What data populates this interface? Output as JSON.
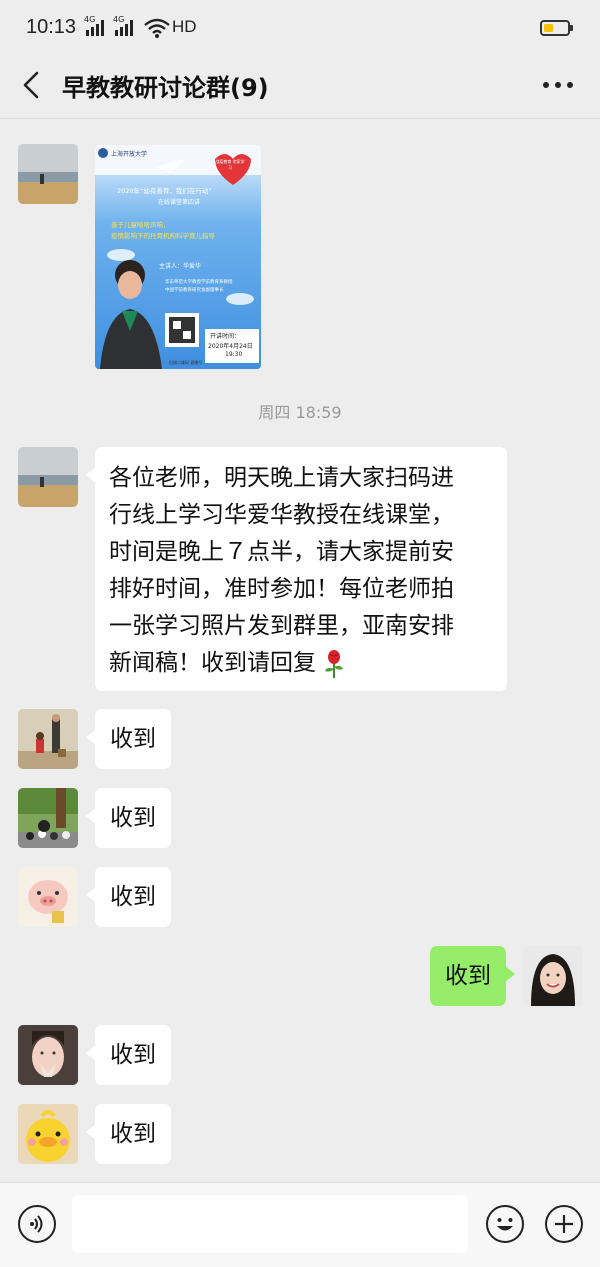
{
  "status_bar": {
    "time": "10:13",
    "network": "HD",
    "signal_labels": [
      "4G",
      "4G"
    ]
  },
  "header": {
    "title": "早教教研讨论群(9)"
  },
  "poster": {
    "university": "上海开放大学",
    "heart_text": "战疫教育 宅家学习",
    "headline": "2020年“幼有善育，我们在行动”",
    "subheadline": "在线课堂第四讲",
    "topic_line1": "善于儿童哈哈声响，",
    "topic_line2": "疫情影响下的托育机构科学育儿指导",
    "speaker": "主讲人：华爱华",
    "bio_line1": "华东师范大学教授学前教育系教授",
    "bio_line2": "中国学前教育研究会副理事长",
    "time_label": "开讲时间：",
    "date": "2020年4月24日",
    "clock": "19:30",
    "scan_hint": "扫描二维码 直播号"
  },
  "timestamp": "周四 18:59",
  "messages": {
    "long": "各位老师，明天晚上请大家扫码进行线上学习华爱华教授在线课堂，时间是晚上７点半，请大家提前安排好时间，准时参加！每位老师拍一张学习照片发到群里，亚南安排新闻稿！收到请回复",
    "long_lines": [
      "各位老师，明天晚上请大家扫码进",
      "行线上学习华爱华教授在线课堂，",
      "时间是晚上７点半，请大家提前安",
      "排好时间，准时参加！每位老师拍",
      "一张学习照片发到群里，亚南安排",
      "新闻稿！收到请回复"
    ],
    "reply": "收到"
  },
  "colors": {
    "bg": "#ededed",
    "bubble_self": "#95ec69",
    "bubble_other": "#ffffff",
    "poster_blue": "#5aa3e6"
  },
  "icons": [
    "back-arrow-icon",
    "more-icon",
    "voice-icon",
    "emoji-icon",
    "plus-icon",
    "rose-icon",
    "signal-icon",
    "wifi-icon",
    "battery-icon"
  ]
}
